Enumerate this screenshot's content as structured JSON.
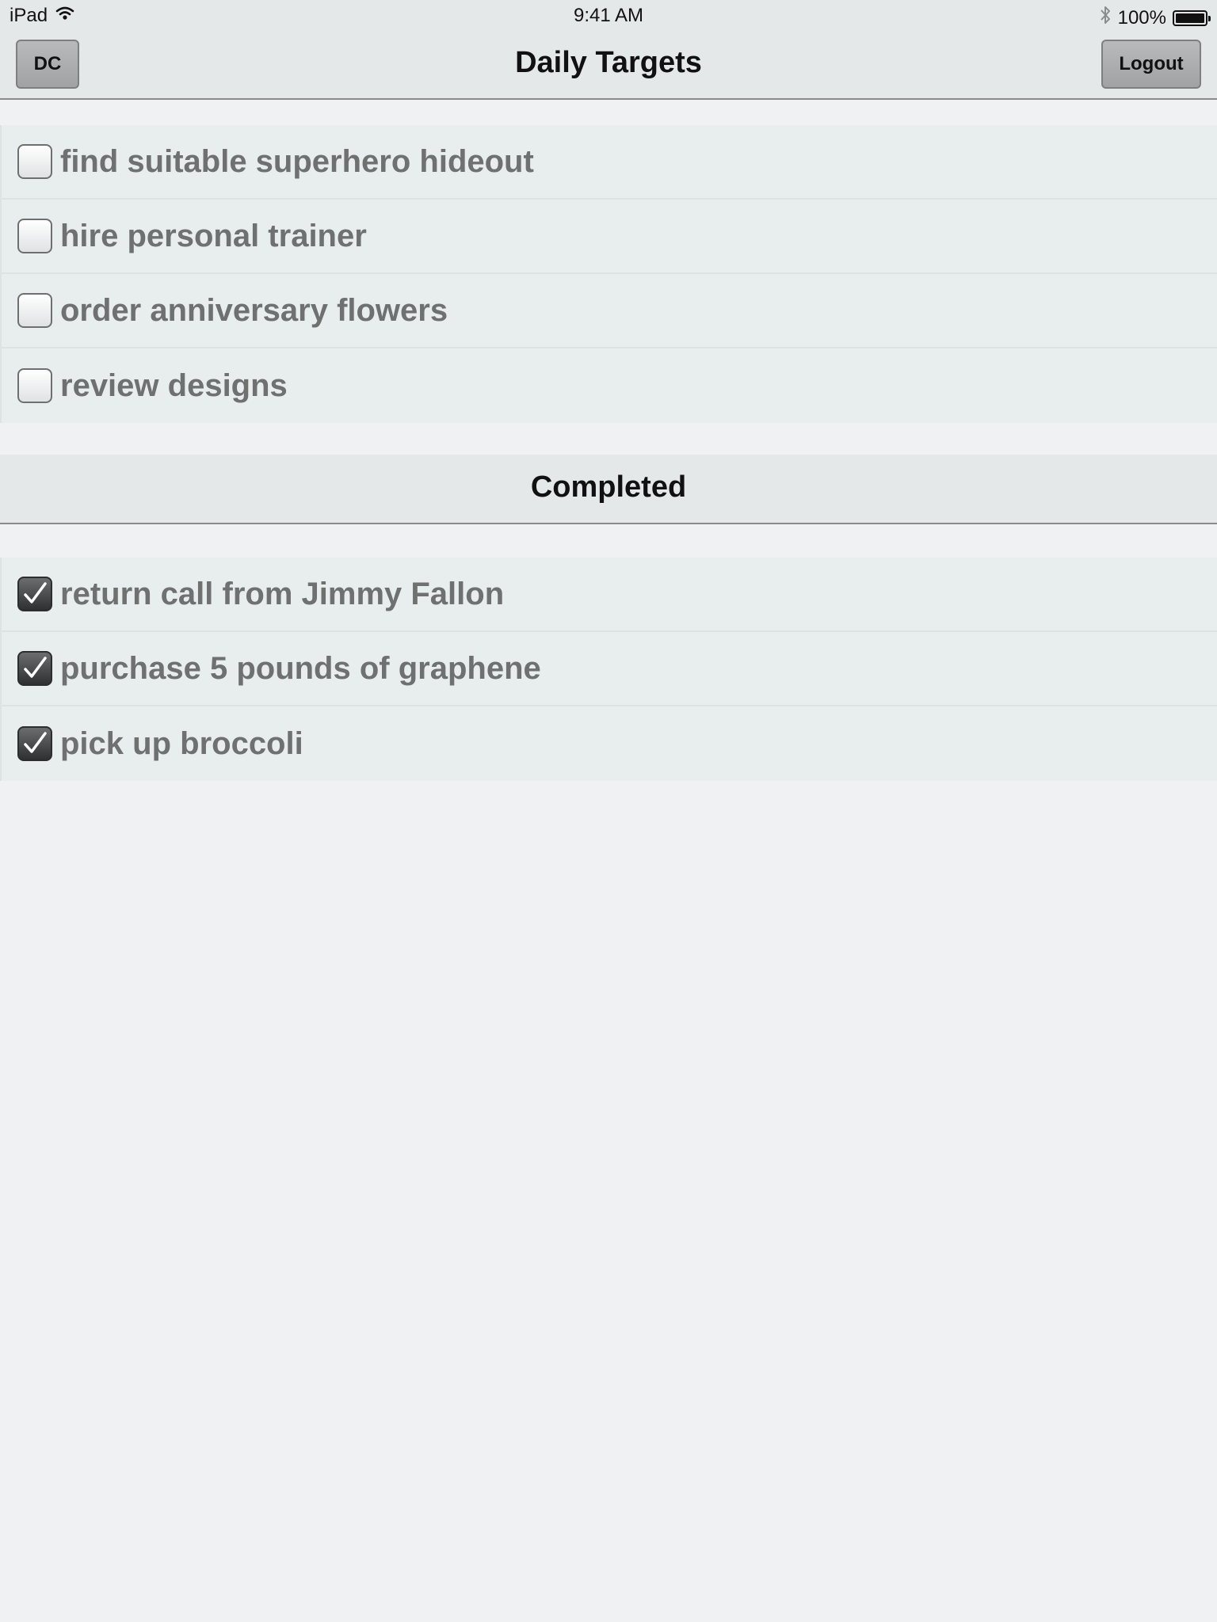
{
  "status_bar": {
    "device": "iPad",
    "time": "9:41 AM",
    "battery": "100%",
    "battery_level": 1.0
  },
  "nav": {
    "title": "Daily Targets",
    "left_button": "DC",
    "right_button": "Logout"
  },
  "targets": [
    {
      "label": "find suitable superhero hideout",
      "checked": false
    },
    {
      "label": "hire personal trainer",
      "checked": false
    },
    {
      "label": "order anniversary flowers",
      "checked": false
    },
    {
      "label": "review designs",
      "checked": false
    }
  ],
  "completed_section": {
    "title": "Completed"
  },
  "completed": [
    {
      "label": "return call from Jimmy Fallon",
      "checked": true
    },
    {
      "label": "purchase 5 pounds of graphene",
      "checked": true
    },
    {
      "label": "pick up broccoli",
      "checked": true
    }
  ]
}
